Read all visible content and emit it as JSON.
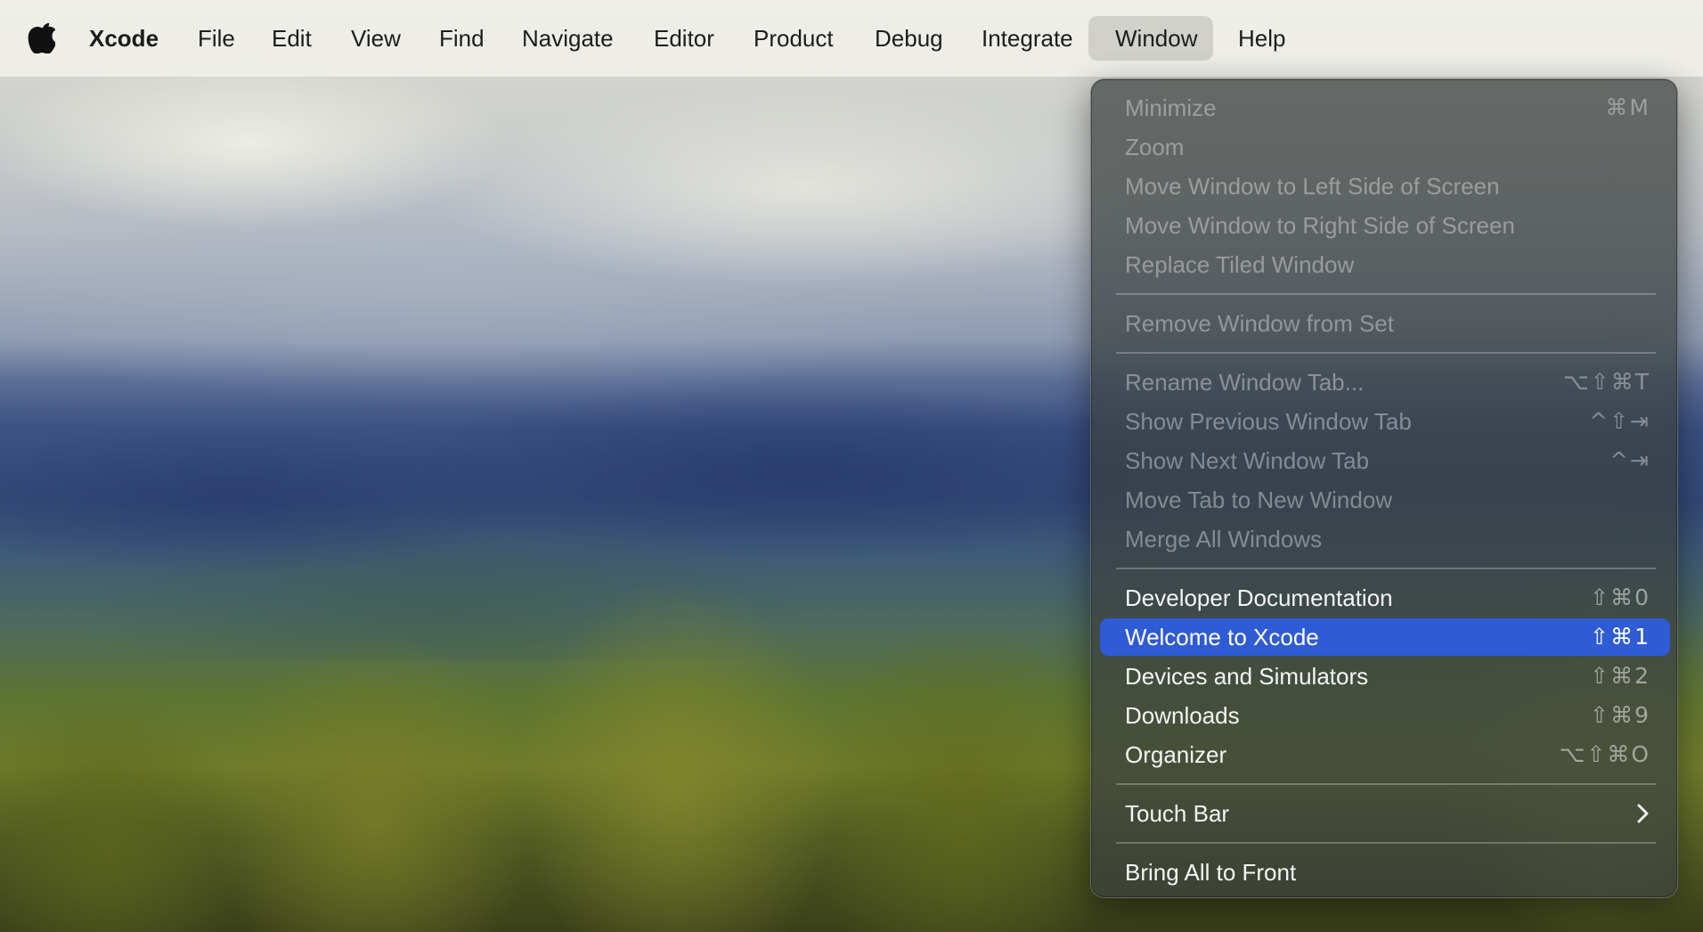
{
  "menubar": {
    "apple_icon": "apple-logo-icon",
    "items": [
      {
        "label": "Xcode"
      },
      {
        "label": "File"
      },
      {
        "label": "Edit"
      },
      {
        "label": "View"
      },
      {
        "label": "Find"
      },
      {
        "label": "Navigate"
      },
      {
        "label": "Editor"
      },
      {
        "label": "Product"
      },
      {
        "label": "Debug"
      },
      {
        "label": "Integrate"
      },
      {
        "label": "Window"
      },
      {
        "label": "Help"
      }
    ],
    "active_menu": "Window"
  },
  "window_menu": {
    "items": [
      {
        "label": "Minimize",
        "shortcut": "⌘M",
        "enabled": false
      },
      {
        "label": "Zoom",
        "shortcut": "",
        "enabled": false
      },
      {
        "label": "Move Window to Left Side of Screen",
        "shortcut": "",
        "enabled": false
      },
      {
        "label": "Move Window to Right Side of Screen",
        "shortcut": "",
        "enabled": false
      },
      {
        "label": "Replace Tiled Window",
        "shortcut": "",
        "enabled": false
      },
      {
        "label": "Remove Window from Set",
        "shortcut": "",
        "enabled": false
      },
      {
        "label": "Rename Window Tab...",
        "shortcut": "⌥⇧⌘T",
        "enabled": false
      },
      {
        "label": "Show Previous Window Tab",
        "shortcut": "^⇧⇥",
        "enabled": false
      },
      {
        "label": "Show Next Window Tab",
        "shortcut": "^⇥",
        "enabled": false
      },
      {
        "label": "Move Tab to New Window",
        "shortcut": "",
        "enabled": false
      },
      {
        "label": "Merge All Windows",
        "shortcut": "",
        "enabled": false
      },
      {
        "label": "Developer Documentation",
        "shortcut": "⇧⌘0",
        "enabled": true
      },
      {
        "label": "Welcome to Xcode",
        "shortcut": "⇧⌘1",
        "enabled": true,
        "selected": true
      },
      {
        "label": "Devices and Simulators",
        "shortcut": "⇧⌘2",
        "enabled": true
      },
      {
        "label": "Downloads",
        "shortcut": "⇧⌘9",
        "enabled": true
      },
      {
        "label": "Organizer",
        "shortcut": "⌥⇧⌘O",
        "enabled": true
      },
      {
        "label": "Touch Bar",
        "shortcut": "",
        "enabled": true,
        "submenu": true,
        "icon": "chevron-right-icon"
      },
      {
        "label": "Bring All to Front",
        "shortcut": "",
        "enabled": true
      }
    ]
  },
  "colors": {
    "selection": "#2f5bd4",
    "menubar_bg": "#f0efea"
  }
}
